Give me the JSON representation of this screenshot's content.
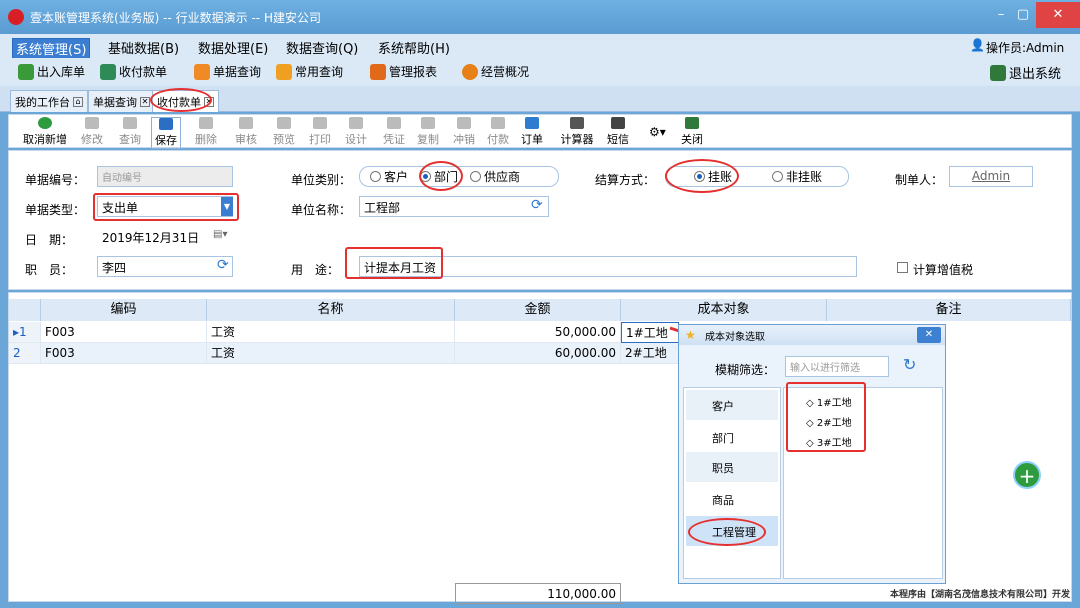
{
  "window": {
    "title": "壹本账管理系统(业务版) -- 行业数据演示 -- H建安公司",
    "min": "–",
    "max": "▢",
    "close": "✕"
  },
  "menu": [
    "系统管理(S)",
    "基础数据(B)",
    "数据处理(E)",
    "数据查询(Q)",
    "系统帮助(H)"
  ],
  "operator": "操作员:Admin",
  "quick": [
    "出入库单",
    "收付款单",
    "单据查询",
    "常用查询",
    "管理报表",
    "经营概况"
  ],
  "exit": "退出系统",
  "tabs": [
    "我的工作台",
    "单据查询",
    "收付款单"
  ],
  "toolbar": [
    "取消新增",
    "修改",
    "查询",
    "保存",
    "删除",
    "审核",
    "预览",
    "打印",
    "设计",
    "凭证",
    "复制",
    "冲销",
    "付款",
    "订单",
    "计算器",
    "短信",
    "关闭"
  ],
  "form": {
    "no_label": "单据编号：",
    "no_value": "自动编号",
    "type_label": "单据类型：",
    "type_value": "支出单",
    "date_label": "日　期：",
    "date_value": "2019年12月31日",
    "staff_label": "职　员：",
    "staff_value": "李四",
    "unit_cat_label": "单位类别：",
    "unit_cats": [
      "客户",
      "部门",
      "供应商"
    ],
    "unit_name_label": "单位名称：",
    "unit_name_value": "工程部",
    "use_label": "用　途：",
    "use_value": "计提本月工资",
    "settle_label": "结算方式：",
    "settle_opts": [
      "挂账",
      "非挂账"
    ],
    "maker_label": "制单人：",
    "maker_value": "Admin",
    "vat_label": "计算增值税"
  },
  "grid": {
    "headers": [
      "编码",
      "名称",
      "金额",
      "成本对象",
      "备注"
    ],
    "rows": [
      {
        "idx": "1",
        "code": "F003",
        "name": "工资",
        "amount": "50,000.00",
        "cost": "1#工地"
      },
      {
        "idx": "2",
        "code": "F003",
        "name": "工资",
        "amount": "60,000.00",
        "cost": "2#工地"
      }
    ],
    "total": "110,000.00"
  },
  "popup": {
    "title": "成本对象选取",
    "filter_label": "模糊筛选：",
    "filter_placeholder": "输入以进行筛选",
    "categories": [
      "客户",
      "部门",
      "职员",
      "商品",
      "工程管理"
    ],
    "items": [
      "1#工地",
      "2#工地",
      "3#工地"
    ]
  },
  "footer": "本程序由【湖南名茂信息技术有限公司】开发"
}
